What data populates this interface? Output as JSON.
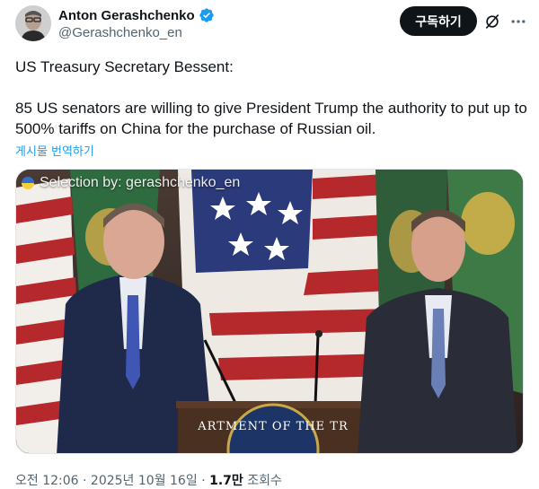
{
  "author": {
    "display_name": "Anton Gerashchenko",
    "handle": "@Gerashchenko_en",
    "verified": true,
    "verified_color": "#1d9bf0"
  },
  "actions": {
    "subscribe_label": "구독하기",
    "grok_icon": "grok-icon",
    "more_icon": "more-icon"
  },
  "tweet": {
    "line1": "US Treasury Secretary Bessent:",
    "line2": "85 US senators are willing to give President Trump the authority to put up to 500% tariffs on China for the purchase of Russian oil.",
    "translate_label": "게시물 번역하기"
  },
  "media": {
    "watermark": "Selection by: gerashchenko_en",
    "seal_text": "ARTMENT OF THE TR"
  },
  "meta": {
    "time": "오전 12:06",
    "separator": "·",
    "date": "2025년 10월 16일",
    "views_count": "1.7만",
    "views_label": "조회수"
  }
}
